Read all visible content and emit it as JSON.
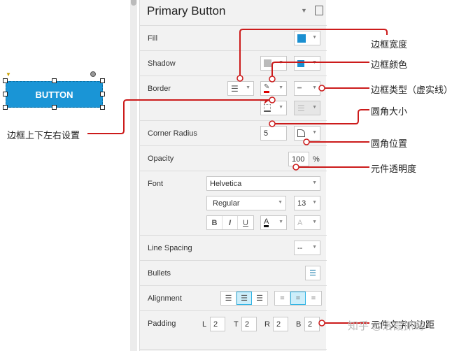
{
  "canvas": {
    "button_label": "BUTTON",
    "annotation_left": "边框上下左右设置"
  },
  "panel": {
    "title": "Primary Button",
    "fill": "Fill",
    "fill_color": "#1a8fd1",
    "shadow": "Shadow",
    "border": "Border",
    "corner_radius": "Corner Radius",
    "corner_value": "5",
    "opacity": "Opacity",
    "opacity_value": "100",
    "opacity_unit": "%",
    "font": "Font",
    "font_family": "Helvetica",
    "font_weight": "Regular",
    "font_size": "13",
    "bold": "B",
    "italic": "I",
    "underline": "U",
    "text_color": "A",
    "text_shadow": "A",
    "line_spacing": "Line Spacing",
    "line_spacing_value": "--",
    "bullets": "Bullets",
    "alignment": "Alignment",
    "padding": "Padding",
    "pad": {
      "L": "2",
      "T": "2",
      "R": "2",
      "B": "2"
    },
    "pad_labels": {
      "L": "L",
      "T": "T",
      "R": "R",
      "B": "B"
    }
  },
  "annotations": {
    "border_width": "边框宽度",
    "border_color": "边框颜色",
    "border_type": "边框类型（虚实线）",
    "corner_size": "圆角大小",
    "corner_position": "圆角位置",
    "opacity": "元件透明度",
    "padding": "元件文字内边距"
  },
  "watermark": "知乎 @洛霞抓鸾",
  "accent": "#cc1b1b"
}
